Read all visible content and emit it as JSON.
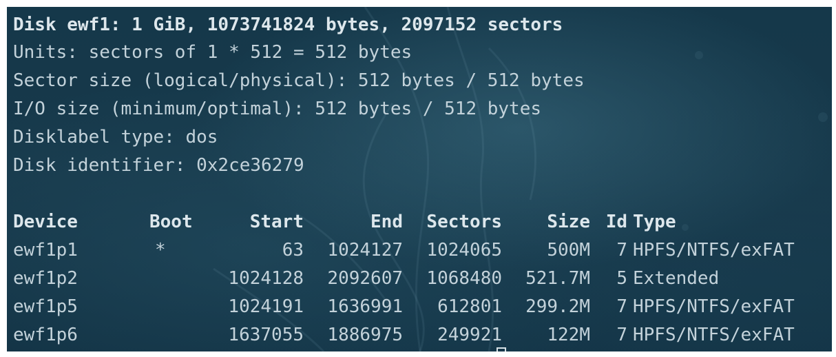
{
  "header": {
    "disk_line": "Disk ewf1: 1 GiB, 1073741824 bytes, 2097152 sectors",
    "units_line": "Units: sectors of 1 * 512 = 512 bytes",
    "sector_size_line": "Sector size (logical/physical): 512 bytes / 512 bytes",
    "io_size_line": "I/O size (minimum/optimal): 512 bytes / 512 bytes",
    "disklabel_line": "Disklabel type: dos",
    "identifier_line": "Disk identifier: 0x2ce36279"
  },
  "table": {
    "columns": [
      "Device",
      "Boot",
      "Start",
      "End",
      "Sectors",
      "Size",
      "Id",
      "Type"
    ],
    "rows": [
      [
        "ewf1p1",
        "*",
        "63",
        "1024127",
        "1024065",
        "500M",
        "7",
        "HPFS/NTFS/exFAT"
      ],
      [
        "ewf1p2",
        "",
        "1024128",
        "2092607",
        "1068480",
        "521.7M",
        "5",
        "Extended"
      ],
      [
        "ewf1p5",
        "",
        "1024191",
        "1636991",
        "612801",
        "299.2M",
        "7",
        "HPFS/NTFS/exFAT"
      ],
      [
        "ewf1p6",
        "",
        "1637055",
        "1886975",
        "249921",
        "122M",
        "7",
        "HPFS/NTFS/exFAT"
      ]
    ]
  },
  "colors": {
    "background": "#17394b",
    "text": "#c3d2da",
    "bold_text": "#dde7ec"
  }
}
